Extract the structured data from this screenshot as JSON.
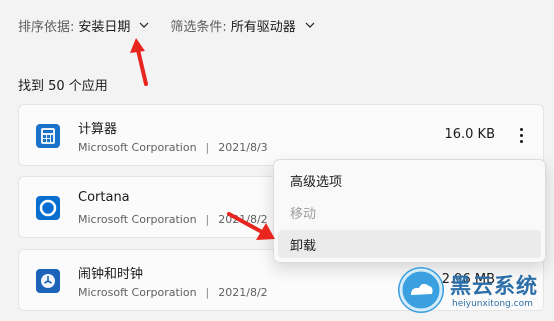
{
  "filters": {
    "sort": {
      "label": "排序依据:",
      "value": "安装日期"
    },
    "filter": {
      "label": "筛选条件:",
      "value": "所有驱动器"
    }
  },
  "result_count": "找到 50 个应用",
  "apps": [
    {
      "name": "计算器",
      "publisher": "Microsoft Corporation",
      "date": "2021/8/3",
      "size": "16.0 KB",
      "icon": "calculator-icon"
    },
    {
      "name": "Cortana",
      "publisher": "Microsoft Corporation",
      "date": "2021/8/2",
      "size": "",
      "icon": "cortana-icon"
    },
    {
      "name": "闹钟和时钟",
      "publisher": "Microsoft Corporation",
      "date": "2021/8/2",
      "size": "2.96 MB",
      "icon": "alarm-clock-icon"
    }
  ],
  "context_menu": {
    "advanced": "高级选项",
    "move": "移动",
    "uninstall": "卸载"
  },
  "watermark": {
    "text": "黑云系统",
    "url": "heiyunxitong.com"
  },
  "colors": {
    "annotation_arrow": "#e8251e",
    "accent": "#0067c0"
  }
}
